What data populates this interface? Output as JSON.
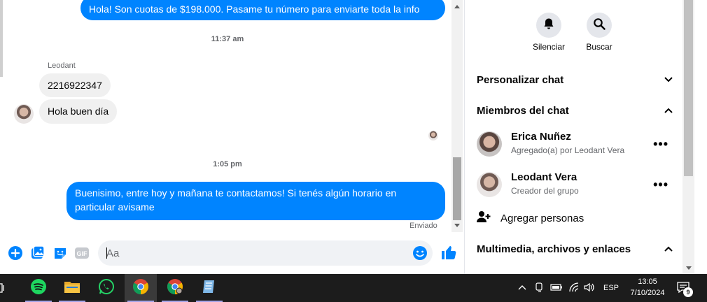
{
  "chat": {
    "messages": [
      {
        "text": "Hola! Son cuotas de $198.000. Pasame tu número para enviarte toda la info"
      },
      {
        "text": "2216922347"
      },
      {
        "text": "Hola buen día"
      },
      {
        "text": "Buenisimo, entre hoy y mañana te contactamos! Si tenés algún horario en"
      },
      {
        "text": "particular avisame"
      }
    ],
    "timestamps": [
      "11:37 am",
      "1:05 pm"
    ],
    "sender_name": "Leodant",
    "status": "Enviado",
    "composer": {
      "placeholder": "Aa"
    }
  },
  "panel": {
    "actions": [
      {
        "label": "Silenciar",
        "icon": "bell-icon"
      },
      {
        "label": "Buscar",
        "icon": "search-icon"
      }
    ],
    "sections": {
      "customize": "Personalizar chat",
      "members": "Miembros del chat",
      "media": "Multimedia, archivos y enlaces"
    },
    "members": [
      {
        "name": "Erica Nuñez",
        "subtitle": "Agregado(a) por Leodant Vera"
      },
      {
        "name": "Leodant Vera",
        "subtitle": "Creador del grupo"
      }
    ],
    "add_people": "Agregar personas"
  },
  "taskbar": {
    "apps": [
      {
        "name": "spotify",
        "color": "#1ed760"
      },
      {
        "name": "file-explorer",
        "color": "#f6c343"
      },
      {
        "name": "whatsapp",
        "color": "#25d366"
      },
      {
        "name": "chrome",
        "color": "#4285f4"
      },
      {
        "name": "chrome-profile-2",
        "color": "#4285f4"
      },
      {
        "name": "notes",
        "color": "#7fb8e8"
      }
    ],
    "language": "ESP",
    "time": "13:05",
    "date": "7/10/2024",
    "notifications": "9"
  },
  "colors": {
    "accent": "#0084ff",
    "taskbar": "#1c1c1c"
  }
}
